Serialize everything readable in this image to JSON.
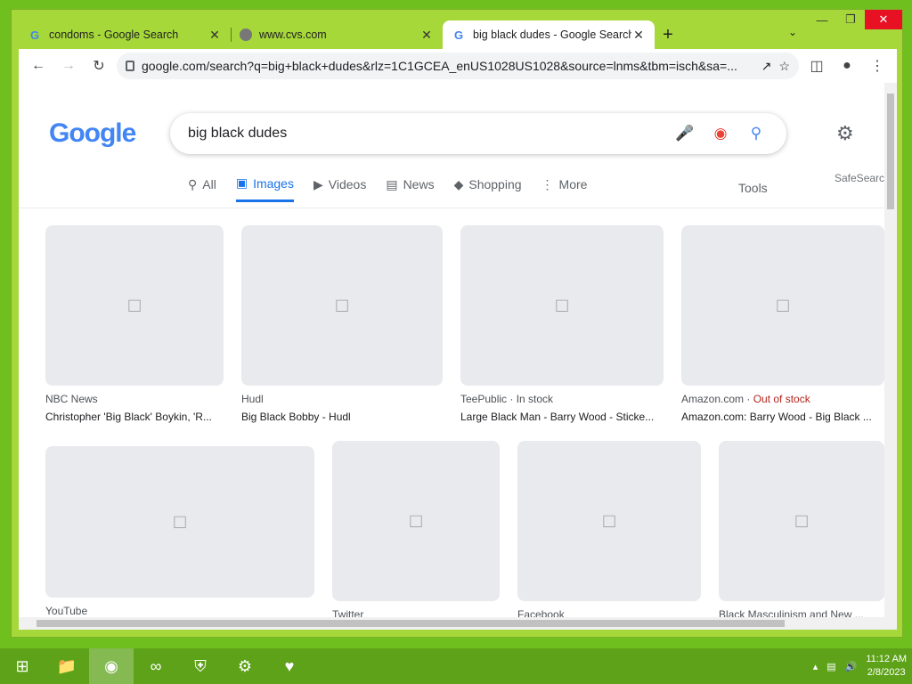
{
  "tabs": [
    {
      "title": "condoms - Google Search",
      "icon": "google-g-icon"
    },
    {
      "title": "www.cvs.com",
      "icon": "globe-icon"
    },
    {
      "title": "big black dudes - Google Search",
      "icon": "google-g-icon"
    }
  ],
  "address_bar": {
    "url": "google.com/search?q=big+black+dudes&rlz=1C1GCEA_enUS1028US1028&source=lnms&tbm=isch&sa=..."
  },
  "search": {
    "logo": "Google",
    "query": "big black dudes"
  },
  "nav": {
    "items": [
      "All",
      "Images",
      "Videos",
      "News",
      "Shopping",
      "More"
    ],
    "tools": "Tools",
    "safesearch": "SafeSearch"
  },
  "results": [
    {
      "source": "NBC News",
      "title": "Christopher 'Big Black' Boykin, 'R..."
    },
    {
      "source": "Hudl",
      "title": "Big Black Bobby - Hudl"
    },
    {
      "source": "TeePublic · In stock",
      "title": "Large Black Man - Barry Wood - Sticke..."
    },
    {
      "source": "Amazon.com",
      "stock": "Out of stock",
      "title": "Amazon.com: Barry Wood - Big Black ..."
    },
    {
      "source": "YouTube",
      "title": ""
    },
    {
      "source": "Twitter",
      "title": ""
    },
    {
      "source": "Facebook",
      "title": ""
    },
    {
      "source": "Black Masculinism and New ...",
      "title": ""
    }
  ],
  "taskbar": {
    "time": "11:12 AM",
    "date": "2/8/2023"
  },
  "colors": {
    "desktop": "#6fbf1e",
    "window_frame": "#a6d83a",
    "accent": "#1a73e8"
  }
}
